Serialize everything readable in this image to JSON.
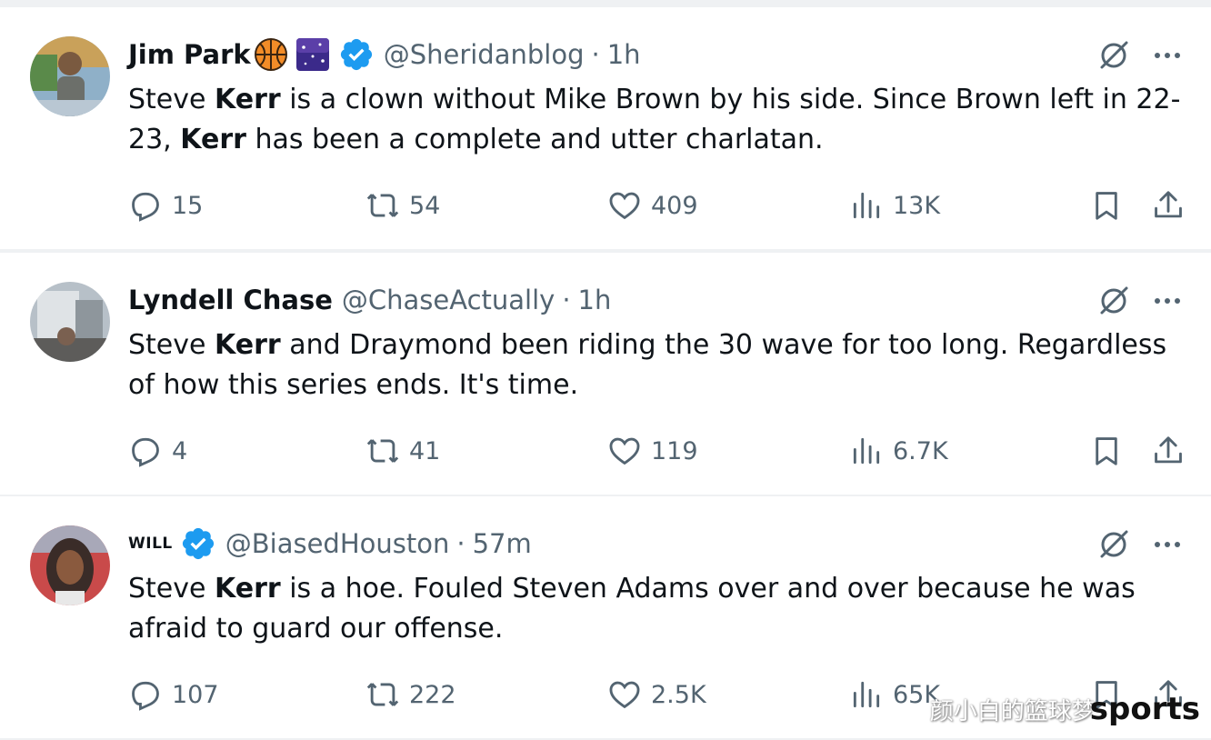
{
  "tweets": [
    {
      "name": "Jim Park",
      "emojis": [
        "basketball-icon",
        "night-sky-icon"
      ],
      "verified": true,
      "handle": "@Sheridanblog",
      "sep": "·",
      "time": "1h",
      "text_parts": [
        {
          "t": "Steve ",
          "bold": false
        },
        {
          "t": "Kerr",
          "bold": true
        },
        {
          "t": " is a clown without Mike Brown by his side. Since Brown left in 22-23, ",
          "bold": false
        },
        {
          "t": "Kerr",
          "bold": true
        },
        {
          "t": " has been a complete and utter charlatan.",
          "bold": false
        }
      ],
      "replies": "15",
      "reposts": "54",
      "likes": "409",
      "views": "13K"
    },
    {
      "name": "Lyndell Chase",
      "emojis": [],
      "verified": false,
      "handle": "@ChaseActually",
      "sep": "·",
      "time": "1h",
      "text_parts": [
        {
          "t": "Steve ",
          "bold": false
        },
        {
          "t": "Kerr",
          "bold": true
        },
        {
          "t": " and Draymond been riding the 30 wave for too long. Regardless of how this series ends. It's time.",
          "bold": false
        }
      ],
      "replies": "4",
      "reposts": "41",
      "likes": "119",
      "views": "6.7K"
    },
    {
      "name": "WILL",
      "emojis": [],
      "verified": true,
      "handle": "@BiasedHouston",
      "sep": "·",
      "time": "57m",
      "text_parts": [
        {
          "t": "Steve ",
          "bold": false
        },
        {
          "t": "Kerr",
          "bold": true
        },
        {
          "t": " is a hoe. Fouled Steven Adams over and over because he was afraid to guard our offense.",
          "bold": false
        }
      ],
      "replies": "107",
      "reposts": "222",
      "likes": "2.5K",
      "views": "65K"
    }
  ],
  "colors": {
    "background": "#eff1f3",
    "card": "#ffffff",
    "text": "#0f1419",
    "secondary": "#536471",
    "verified": "#1d9bf0"
  },
  "icons": {
    "reply": "reply-icon",
    "repost": "repost-icon",
    "like": "heart-icon",
    "views": "views-icon",
    "bookmark": "bookmark-icon",
    "share": "share-icon",
    "grok": "grok-icon",
    "more": "more-icon"
  },
  "watermark": {
    "cn": "颜小白的篮球梦",
    "sports": "sports"
  }
}
